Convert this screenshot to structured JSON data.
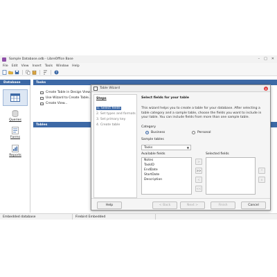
{
  "window": {
    "title": "Sample Database.odb - LibreOffice Base",
    "controls": [
      "–",
      "□",
      "✕"
    ]
  },
  "menubar": [
    "File",
    "Edit",
    "View",
    "Insert",
    "Tools",
    "Window",
    "Help"
  ],
  "toolbar": {
    "icons": [
      "new-icon",
      "open-icon",
      "save-icon",
      "copy-icon",
      "paste-icon",
      "sort-icon",
      "help-icon"
    ]
  },
  "database_pane": {
    "header": "Database",
    "items": [
      {
        "label": "Tables",
        "icon": "tables-icon",
        "selected": true
      },
      {
        "label": "Queries",
        "icon": "queries-icon"
      },
      {
        "label": "Forms",
        "icon": "forms-icon"
      },
      {
        "label": "Reports",
        "icon": "reports-icon"
      }
    ]
  },
  "tasks": {
    "header": "Tasks",
    "items": [
      "Create Table in Design View...",
      "Use Wizard to Create Table...",
      "Create View..."
    ]
  },
  "tables_header": "Tables",
  "statusbar": [
    "Embedded database",
    "Firebird Embedded"
  ],
  "dialog": {
    "title": "Table Wizard",
    "close": "✕",
    "steps_title": "Steps",
    "steps": [
      "1. Select fields",
      "2. Set types and formats",
      "3. Set primary key",
      "4. Create table"
    ],
    "active_step": 0,
    "heading": "Select fields for your table",
    "description": "This wizard helps you to create a table for your database. After selecting a table category and a sample table, choose the fields you want to include in your table. You can include fields from more than one sample table.",
    "category_label": "Category",
    "category_options": [
      "Business",
      "Personal"
    ],
    "category_selected": "Business",
    "sample_tables_label": "Sample tables",
    "sample_table_value": "Tasks",
    "available_label": "Available fields",
    "available_fields": [
      "Notes",
      "TaskID",
      "EndDate",
      "StartDate",
      "Description"
    ],
    "selected_label": "Selected fields",
    "move_buttons": [
      ">",
      ">>",
      "<",
      "<<"
    ],
    "order_buttons": [
      "^",
      "v"
    ],
    "buttons": {
      "help": "Help",
      "back": "< Back",
      "next": "Next >",
      "finish": "Finish",
      "cancel": "Cancel"
    }
  }
}
